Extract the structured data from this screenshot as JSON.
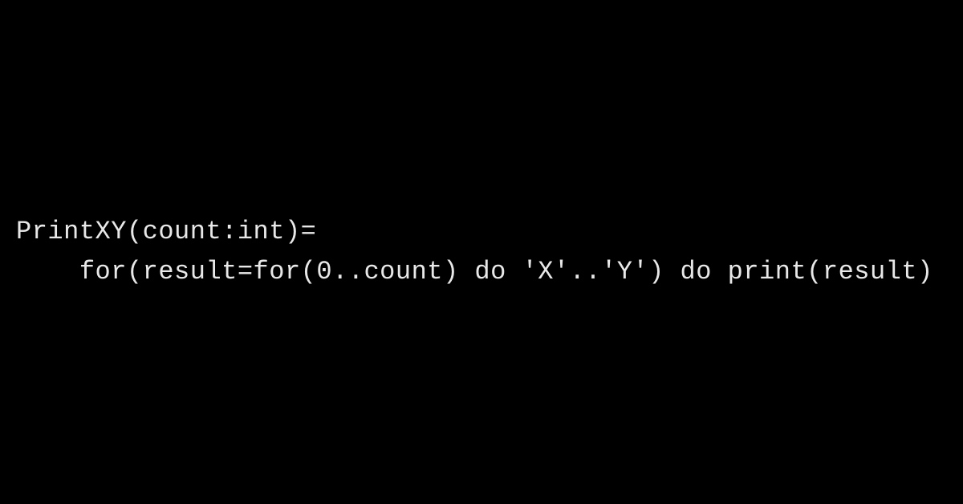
{
  "code": {
    "line1": "PrintXY(count:int)=",
    "line2": "    for(result=for(0..count) do 'X'..'Y') do print(result)"
  }
}
